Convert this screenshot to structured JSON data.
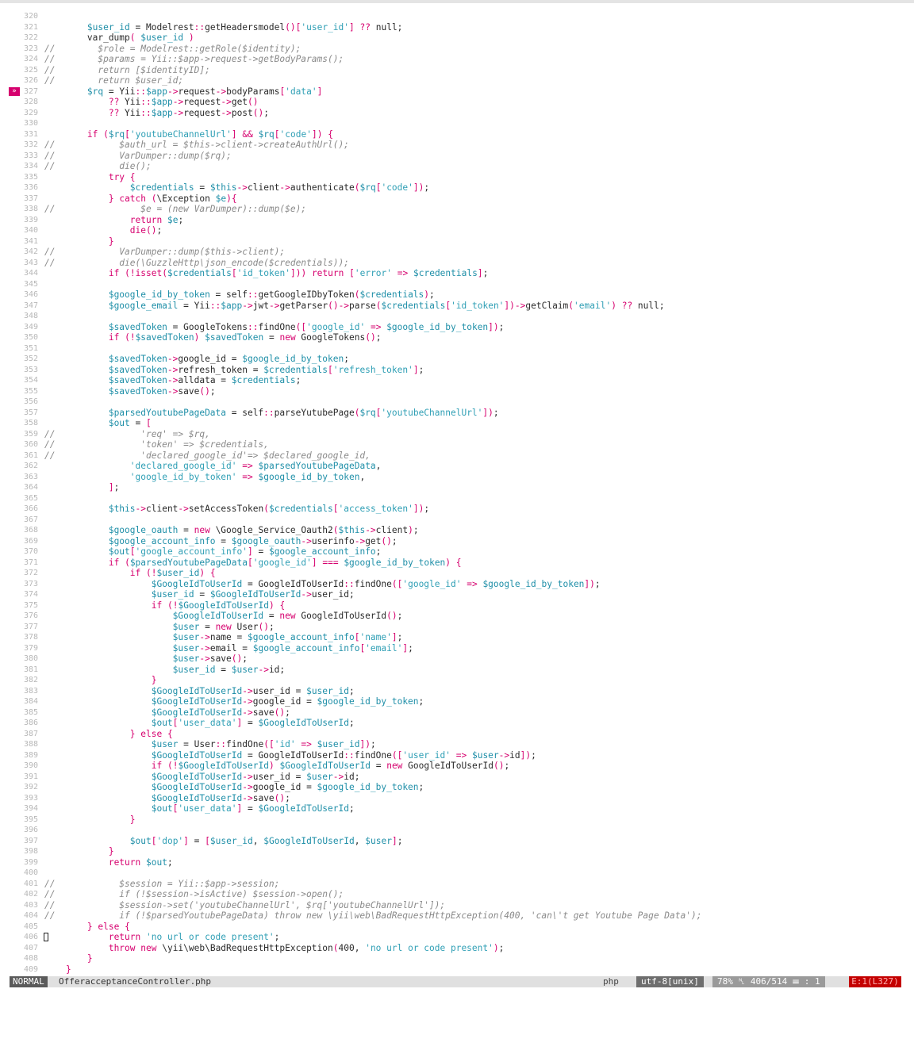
{
  "editor": {
    "current_line": 327,
    "cursor_line": 406,
    "lines": [
      {
        "n": "320",
        "t": "",
        "c": false
      },
      {
        "n": "321",
        "t": "        $user_id = Modelrest::getHeadersmodel()['user_id'] ?? null;",
        "c": false
      },
      {
        "n": "322",
        "t": "        var_dump( $user_id )",
        "c": false
      },
      {
        "n": "323",
        "t": "//        $role = Modelrest::getRole($identity);",
        "c": true
      },
      {
        "n": "324",
        "t": "//        $params = Yii::$app->request->getBodyParams();",
        "c": true
      },
      {
        "n": "325",
        "t": "//        return [$identityID];",
        "c": true
      },
      {
        "n": "326",
        "t": "//        return $user_id;",
        "c": true
      },
      {
        "n": "327",
        "t": "        $rq = Yii::$app->request->bodyParams['data']",
        "c": false
      },
      {
        "n": "328",
        "t": "            ?? Yii::$app->request->get()",
        "c": false
      },
      {
        "n": "329",
        "t": "            ?? Yii::$app->request->post();",
        "c": false
      },
      {
        "n": "330",
        "t": "",
        "c": false
      },
      {
        "n": "331",
        "t": "        if ($rq['youtubeChannelUrl'] && $rq['code']) {",
        "c": false
      },
      {
        "n": "332",
        "t": "//            $auth_url = $this->client->createAuthUrl();",
        "c": true
      },
      {
        "n": "333",
        "t": "//            VarDumper::dump($rq);",
        "c": true
      },
      {
        "n": "334",
        "t": "//            die();",
        "c": true
      },
      {
        "n": "335",
        "t": "            try {",
        "c": false
      },
      {
        "n": "336",
        "t": "                $credentials = $this->client->authenticate($rq['code']);",
        "c": false
      },
      {
        "n": "337",
        "t": "            } catch (\\Exception $e){",
        "c": false
      },
      {
        "n": "338",
        "t": "//                $e = (new VarDumper)::dump($e);",
        "c": true
      },
      {
        "n": "339",
        "t": "                return $e;",
        "c": false
      },
      {
        "n": "340",
        "t": "                die();",
        "c": false
      },
      {
        "n": "341",
        "t": "            }",
        "c": false
      },
      {
        "n": "342",
        "t": "//            VarDumper::dump($this->client);",
        "c": true
      },
      {
        "n": "343",
        "t": "//            die(\\GuzzleHttp\\json_encode($credentials));",
        "c": true
      },
      {
        "n": "344",
        "t": "            if (!isset($credentials['id_token'])) return ['error' => $credentials];",
        "c": false
      },
      {
        "n": "345",
        "t": "",
        "c": false
      },
      {
        "n": "346",
        "t": "            $google_id_by_token = self::getGoogleIDbyToken($credentials);",
        "c": false
      },
      {
        "n": "347",
        "t": "            $google_email = Yii::$app->jwt->getParser()->parse($credentials['id_token'])->getClaim('email') ?? null;",
        "c": false
      },
      {
        "n": "348",
        "t": "",
        "c": false
      },
      {
        "n": "349",
        "t": "            $savedToken = GoogleTokens::findOne(['google_id' => $google_id_by_token]);",
        "c": false
      },
      {
        "n": "350",
        "t": "            if (!$savedToken) $savedToken = new GoogleTokens();",
        "c": false
      },
      {
        "n": "351",
        "t": "",
        "c": false
      },
      {
        "n": "352",
        "t": "            $savedToken->google_id = $google_id_by_token;",
        "c": false
      },
      {
        "n": "353",
        "t": "            $savedToken->refresh_token = $credentials['refresh_token'];",
        "c": false
      },
      {
        "n": "354",
        "t": "            $savedToken->alldata = $credentials;",
        "c": false
      },
      {
        "n": "355",
        "t": "            $savedToken->save();",
        "c": false
      },
      {
        "n": "356",
        "t": "",
        "c": false
      },
      {
        "n": "357",
        "t": "            $parsedYoutubePageData = self::parseYutubePage($rq['youtubeChannelUrl']);",
        "c": false
      },
      {
        "n": "358",
        "t": "            $out = [",
        "c": false
      },
      {
        "n": "359",
        "t": "//                'req' => $rq,",
        "c": true
      },
      {
        "n": "360",
        "t": "//                'token' => $credentials,",
        "c": true
      },
      {
        "n": "361",
        "t": "//                'declared_google_id'=> $declared_google_id,",
        "c": true
      },
      {
        "n": "362",
        "t": "                'declared_google_id' => $parsedYoutubePageData,",
        "c": false
      },
      {
        "n": "363",
        "t": "                'google_id_by_token' => $google_id_by_token,",
        "c": false
      },
      {
        "n": "364",
        "t": "            ];",
        "c": false
      },
      {
        "n": "365",
        "t": "",
        "c": false
      },
      {
        "n": "366",
        "t": "            $this->client->setAccessToken($credentials['access_token']);",
        "c": false
      },
      {
        "n": "367",
        "t": "",
        "c": false
      },
      {
        "n": "368",
        "t": "            $google_oauth = new \\Google_Service_Oauth2($this->client);",
        "c": false
      },
      {
        "n": "369",
        "t": "            $google_account_info = $google_oauth->userinfo->get();",
        "c": false
      },
      {
        "n": "370",
        "t": "            $out['google_account_info'] = $google_account_info;",
        "c": false
      },
      {
        "n": "371",
        "t": "            if ($parsedYoutubePageData['google_id'] === $google_id_by_token) {",
        "c": false
      },
      {
        "n": "372",
        "t": "                if (!$user_id) {",
        "c": false
      },
      {
        "n": "373",
        "t": "                    $GoogleIdToUserId = GoogleIdToUserId::findOne(['google_id' => $google_id_by_token]);",
        "c": false
      },
      {
        "n": "374",
        "t": "                    $user_id = $GoogleIdToUserId->user_id;",
        "c": false
      },
      {
        "n": "375",
        "t": "                    if (!$GoogleIdToUserId) {",
        "c": false
      },
      {
        "n": "376",
        "t": "                        $GoogleIdToUserId = new GoogleIdToUserId();",
        "c": false
      },
      {
        "n": "377",
        "t": "                        $user = new User();",
        "c": false
      },
      {
        "n": "378",
        "t": "                        $user->name = $google_account_info['name'];",
        "c": false
      },
      {
        "n": "379",
        "t": "                        $user->email = $google_account_info['email'];",
        "c": false
      },
      {
        "n": "380",
        "t": "                        $user->save();",
        "c": false
      },
      {
        "n": "381",
        "t": "                        $user_id = $user->id;",
        "c": false
      },
      {
        "n": "382",
        "t": "                    }",
        "c": false
      },
      {
        "n": "383",
        "t": "                    $GoogleIdToUserId->user_id = $user_id;",
        "c": false
      },
      {
        "n": "384",
        "t": "                    $GoogleIdToUserId->google_id = $google_id_by_token;",
        "c": false
      },
      {
        "n": "385",
        "t": "                    $GoogleIdToUserId->save();",
        "c": false
      },
      {
        "n": "386",
        "t": "                    $out['user_data'] = $GoogleIdToUserId;",
        "c": false
      },
      {
        "n": "387",
        "t": "                } else {",
        "c": false
      },
      {
        "n": "388",
        "t": "                    $user = User::findOne(['id' => $user_id]);",
        "c": false
      },
      {
        "n": "389",
        "t": "                    $GoogleIdToUserId = GoogleIdToUserId::findOne(['user_id' => $user->id]);",
        "c": false
      },
      {
        "n": "390",
        "t": "                    if (!$GoogleIdToUserId) $GoogleIdToUserId = new GoogleIdToUserId();",
        "c": false
      },
      {
        "n": "391",
        "t": "                    $GoogleIdToUserId->user_id = $user->id;",
        "c": false
      },
      {
        "n": "392",
        "t": "                    $GoogleIdToUserId->google_id = $google_id_by_token;",
        "c": false
      },
      {
        "n": "393",
        "t": "                    $GoogleIdToUserId->save();",
        "c": false
      },
      {
        "n": "394",
        "t": "                    $out['user_data'] = $GoogleIdToUserId;",
        "c": false
      },
      {
        "n": "395",
        "t": "                }",
        "c": false
      },
      {
        "n": "396",
        "t": "",
        "c": false
      },
      {
        "n": "397",
        "t": "                $out['dop'] = [$user_id, $GoogleIdToUserId, $user];",
        "c": false
      },
      {
        "n": "398",
        "t": "            }",
        "c": false
      },
      {
        "n": "399",
        "t": "            return $out;",
        "c": false
      },
      {
        "n": "400",
        "t": "",
        "c": false
      },
      {
        "n": "401",
        "t": "//            $session = Yii::$app->session;",
        "c": true
      },
      {
        "n": "402",
        "t": "//            if (!$session->isActive) $session->open();",
        "c": true
      },
      {
        "n": "403",
        "t": "//            $session->set('youtubeChannelUrl', $rq['youtubeChannelUrl']);",
        "c": true
      },
      {
        "n": "404",
        "t": "//            if (!$parsedYoutubePageData) throw new \\yii\\web\\BadRequestHttpException(400, 'can\\'t get Youtube Page Data');",
        "c": true
      },
      {
        "n": "405",
        "t": "        } else {",
        "c": false
      },
      {
        "n": "406",
        "t": "            return 'no url or code present';",
        "c": false
      },
      {
        "n": "407",
        "t": "            throw new \\yii\\web\\BadRequestHttpException(400, 'no url or code present');",
        "c": false
      },
      {
        "n": "408",
        "t": "        }",
        "c": false
      },
      {
        "n": "409",
        "t": "    }",
        "c": false
      }
    ]
  },
  "statusline": {
    "mode": "NORMAL",
    "filename": "OfferacceptanceController.php",
    "filetype": "php",
    "encoding": "utf-8[unix]",
    "position": "78% ␤ 406/514 ☰ : 1",
    "error": "E:1(L327)"
  },
  "colors": {
    "variable": "#1f8fa8",
    "keyword": "#d6006e",
    "string": "#2f9fb5",
    "comment": "#8a8a8a",
    "plain": "#2a2a2a",
    "error_bg": "#c40000",
    "sign_bg": "#d6006e"
  }
}
